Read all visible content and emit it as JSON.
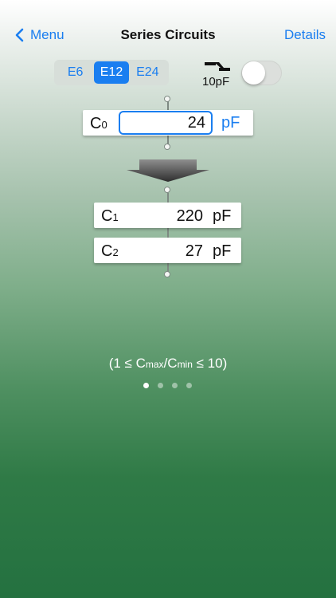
{
  "nav": {
    "back_label": "Menu",
    "title": "Series Circuits",
    "details_label": "Details"
  },
  "series_selector": {
    "options": [
      "E6",
      "E12",
      "E24"
    ],
    "selected": "E12"
  },
  "parasitic": {
    "label": "10pF",
    "enabled": false
  },
  "input": {
    "label_main": "C",
    "label_sub": "0",
    "value": "24",
    "unit": "pF"
  },
  "results": [
    {
      "label_main": "C",
      "label_sub": "1",
      "value": "220",
      "unit": "pF"
    },
    {
      "label_main": "C",
      "label_sub": "2",
      "value": "27",
      "unit": "pF"
    }
  ],
  "constraint": {
    "prefix": "(1 ≤ C",
    "max_sub": "max",
    "slash": "/C",
    "min_sub": "min",
    "suffix": " ≤ 10)"
  },
  "page_indicator": {
    "count": 4,
    "current": 1
  },
  "colors": {
    "accent": "#1a7ef0",
    "wire": "#7e8a83"
  }
}
